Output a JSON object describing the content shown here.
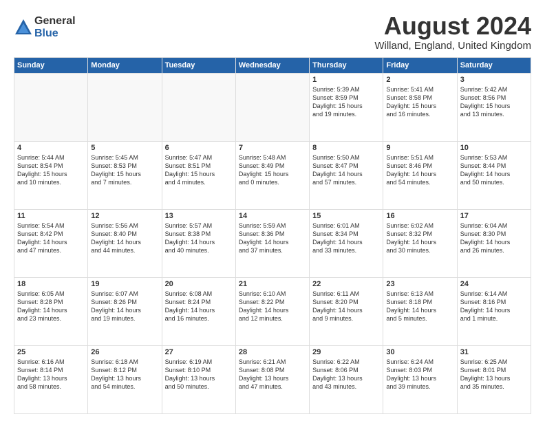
{
  "logo": {
    "general": "General",
    "blue": "Blue"
  },
  "title": "August 2024",
  "location": "Willand, England, United Kingdom",
  "weekdays": [
    "Sunday",
    "Monday",
    "Tuesday",
    "Wednesday",
    "Thursday",
    "Friday",
    "Saturday"
  ],
  "weeks": [
    [
      {
        "day": "",
        "empty": true
      },
      {
        "day": "",
        "empty": true
      },
      {
        "day": "",
        "empty": true
      },
      {
        "day": "",
        "empty": true
      },
      {
        "day": "1",
        "lines": [
          "Sunrise: 5:39 AM",
          "Sunset: 8:59 PM",
          "Daylight: 15 hours",
          "and 19 minutes."
        ]
      },
      {
        "day": "2",
        "lines": [
          "Sunrise: 5:41 AM",
          "Sunset: 8:58 PM",
          "Daylight: 15 hours",
          "and 16 minutes."
        ]
      },
      {
        "day": "3",
        "lines": [
          "Sunrise: 5:42 AM",
          "Sunset: 8:56 PM",
          "Daylight: 15 hours",
          "and 13 minutes."
        ]
      }
    ],
    [
      {
        "day": "4",
        "lines": [
          "Sunrise: 5:44 AM",
          "Sunset: 8:54 PM",
          "Daylight: 15 hours",
          "and 10 minutes."
        ]
      },
      {
        "day": "5",
        "lines": [
          "Sunrise: 5:45 AM",
          "Sunset: 8:53 PM",
          "Daylight: 15 hours",
          "and 7 minutes."
        ]
      },
      {
        "day": "6",
        "lines": [
          "Sunrise: 5:47 AM",
          "Sunset: 8:51 PM",
          "Daylight: 15 hours",
          "and 4 minutes."
        ]
      },
      {
        "day": "7",
        "lines": [
          "Sunrise: 5:48 AM",
          "Sunset: 8:49 PM",
          "Daylight: 15 hours",
          "and 0 minutes."
        ]
      },
      {
        "day": "8",
        "lines": [
          "Sunrise: 5:50 AM",
          "Sunset: 8:47 PM",
          "Daylight: 14 hours",
          "and 57 minutes."
        ]
      },
      {
        "day": "9",
        "lines": [
          "Sunrise: 5:51 AM",
          "Sunset: 8:46 PM",
          "Daylight: 14 hours",
          "and 54 minutes."
        ]
      },
      {
        "day": "10",
        "lines": [
          "Sunrise: 5:53 AM",
          "Sunset: 8:44 PM",
          "Daylight: 14 hours",
          "and 50 minutes."
        ]
      }
    ],
    [
      {
        "day": "11",
        "lines": [
          "Sunrise: 5:54 AM",
          "Sunset: 8:42 PM",
          "Daylight: 14 hours",
          "and 47 minutes."
        ]
      },
      {
        "day": "12",
        "lines": [
          "Sunrise: 5:56 AM",
          "Sunset: 8:40 PM",
          "Daylight: 14 hours",
          "and 44 minutes."
        ]
      },
      {
        "day": "13",
        "lines": [
          "Sunrise: 5:57 AM",
          "Sunset: 8:38 PM",
          "Daylight: 14 hours",
          "and 40 minutes."
        ]
      },
      {
        "day": "14",
        "lines": [
          "Sunrise: 5:59 AM",
          "Sunset: 8:36 PM",
          "Daylight: 14 hours",
          "and 37 minutes."
        ]
      },
      {
        "day": "15",
        "lines": [
          "Sunrise: 6:01 AM",
          "Sunset: 8:34 PM",
          "Daylight: 14 hours",
          "and 33 minutes."
        ]
      },
      {
        "day": "16",
        "lines": [
          "Sunrise: 6:02 AM",
          "Sunset: 8:32 PM",
          "Daylight: 14 hours",
          "and 30 minutes."
        ]
      },
      {
        "day": "17",
        "lines": [
          "Sunrise: 6:04 AM",
          "Sunset: 8:30 PM",
          "Daylight: 14 hours",
          "and 26 minutes."
        ]
      }
    ],
    [
      {
        "day": "18",
        "lines": [
          "Sunrise: 6:05 AM",
          "Sunset: 8:28 PM",
          "Daylight: 14 hours",
          "and 23 minutes."
        ]
      },
      {
        "day": "19",
        "lines": [
          "Sunrise: 6:07 AM",
          "Sunset: 8:26 PM",
          "Daylight: 14 hours",
          "and 19 minutes."
        ]
      },
      {
        "day": "20",
        "lines": [
          "Sunrise: 6:08 AM",
          "Sunset: 8:24 PM",
          "Daylight: 14 hours",
          "and 16 minutes."
        ]
      },
      {
        "day": "21",
        "lines": [
          "Sunrise: 6:10 AM",
          "Sunset: 8:22 PM",
          "Daylight: 14 hours",
          "and 12 minutes."
        ]
      },
      {
        "day": "22",
        "lines": [
          "Sunrise: 6:11 AM",
          "Sunset: 8:20 PM",
          "Daylight: 14 hours",
          "and 9 minutes."
        ]
      },
      {
        "day": "23",
        "lines": [
          "Sunrise: 6:13 AM",
          "Sunset: 8:18 PM",
          "Daylight: 14 hours",
          "and 5 minutes."
        ]
      },
      {
        "day": "24",
        "lines": [
          "Sunrise: 6:14 AM",
          "Sunset: 8:16 PM",
          "Daylight: 14 hours",
          "and 1 minute."
        ]
      }
    ],
    [
      {
        "day": "25",
        "lines": [
          "Sunrise: 6:16 AM",
          "Sunset: 8:14 PM",
          "Daylight: 13 hours",
          "and 58 minutes."
        ]
      },
      {
        "day": "26",
        "lines": [
          "Sunrise: 6:18 AM",
          "Sunset: 8:12 PM",
          "Daylight: 13 hours",
          "and 54 minutes."
        ]
      },
      {
        "day": "27",
        "lines": [
          "Sunrise: 6:19 AM",
          "Sunset: 8:10 PM",
          "Daylight: 13 hours",
          "and 50 minutes."
        ]
      },
      {
        "day": "28",
        "lines": [
          "Sunrise: 6:21 AM",
          "Sunset: 8:08 PM",
          "Daylight: 13 hours",
          "and 47 minutes."
        ]
      },
      {
        "day": "29",
        "lines": [
          "Sunrise: 6:22 AM",
          "Sunset: 8:06 PM",
          "Daylight: 13 hours",
          "and 43 minutes."
        ]
      },
      {
        "day": "30",
        "lines": [
          "Sunrise: 6:24 AM",
          "Sunset: 8:03 PM",
          "Daylight: 13 hours",
          "and 39 minutes."
        ]
      },
      {
        "day": "31",
        "lines": [
          "Sunrise: 6:25 AM",
          "Sunset: 8:01 PM",
          "Daylight: 13 hours",
          "and 35 minutes."
        ]
      }
    ]
  ]
}
